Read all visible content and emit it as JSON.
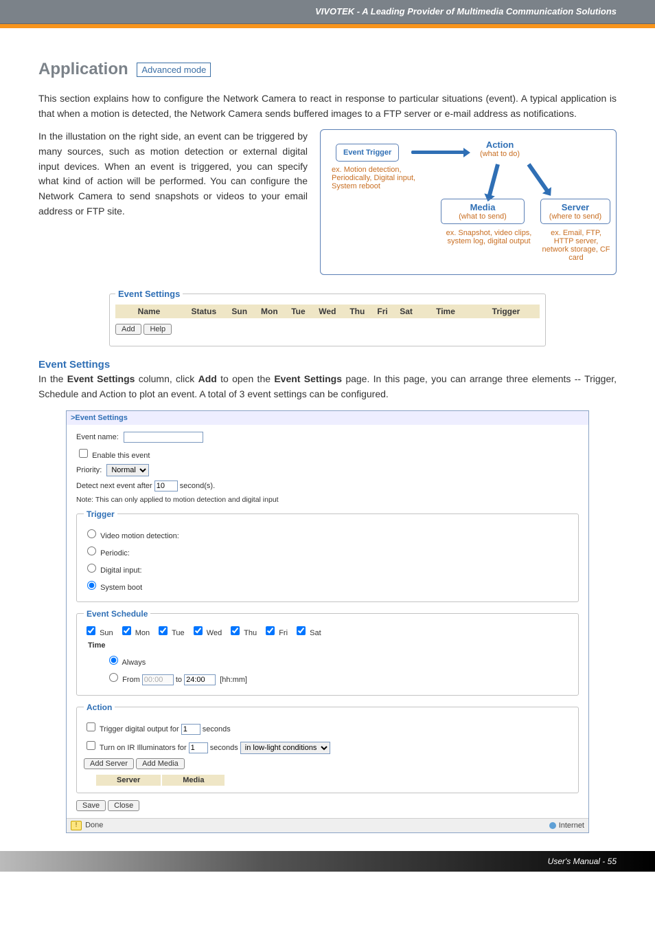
{
  "header": {
    "title": "VIVOTEK - A Leading Provider of Multimedia Communication Solutions"
  },
  "page": {
    "title": "Application",
    "badge": "Advanced mode",
    "intro": "This section explains how to configure the Network Camera to react in response to particular situations (event). A typical application is that when a motion is detected, the Network Camera sends buffered images to a FTP server or e-mail address as notifications.",
    "illustration_text": "In the illustation on the right side, an event can be triggered by many sources, such as motion detection or external digital input devices. When an event is triggered, you can specify what kind of action will be performed. You can configure the Network Camera to send snapshots or videos to your email address or FTP site."
  },
  "diagram": {
    "event_trigger": "Event Trigger",
    "action_title": "Action",
    "action_sub": "(what to do)",
    "media_title": "Media",
    "media_sub": "(what to send)",
    "server_title": "Server",
    "server_sub": "(where to send)",
    "ex1": "ex. Motion detection, Periodically, Digital input, System reboot",
    "ex2": "ex. Snapshot, video clips, system log, digital output",
    "ex3": "ex. Email, FTP, HTTP server, network storage, CF card"
  },
  "event_settings_overview": {
    "legend": "Event Settings",
    "columns": [
      "Name",
      "Status",
      "Sun",
      "Mon",
      "Tue",
      "Wed",
      "Thu",
      "Fri",
      "Sat",
      "Time",
      "Trigger"
    ],
    "add": "Add",
    "help": "Help"
  },
  "event_settings_section": {
    "heading": "Event Settings",
    "body_prefix": "In the ",
    "body_b1": "Event Settings",
    "body_mid1": " column, click ",
    "body_b2": "Add",
    "body_mid2": " to open the ",
    "body_b3": "Event Settings",
    "body_suffix": " page. In this page, you can arrange three elements -- Trigger, Schedule and Action to plot an event. A total of 3 event settings can be configured."
  },
  "modal": {
    "title": ">Event Settings",
    "event_name_label": "Event name:",
    "event_name_value": "",
    "enable_label": "Enable this event",
    "enable_checked": false,
    "priority_label": "Priority:",
    "priority_value": "Normal",
    "detect_prefix": "Detect next event after",
    "detect_value": "10",
    "detect_suffix": "second(s).",
    "note": "Note: This can only applied to motion detection and digital input",
    "trigger": {
      "legend": "Trigger",
      "options": [
        {
          "label": "Video motion detection:",
          "selected": false
        },
        {
          "label": "Periodic:",
          "selected": false
        },
        {
          "label": "Digital input:",
          "selected": false
        },
        {
          "label": "System boot",
          "selected": true
        }
      ]
    },
    "schedule": {
      "legend": "Event Schedule",
      "days": [
        "Sun",
        "Mon",
        "Tue",
        "Wed",
        "Thu",
        "Fri",
        "Sat"
      ],
      "days_checked": [
        true,
        true,
        true,
        true,
        true,
        true,
        true
      ],
      "time_label": "Time",
      "always_label": "Always",
      "always_selected": true,
      "from_label": "From",
      "from_value": "00:00",
      "to_label": "to",
      "to_value": "24:00",
      "hhmm": "[hh:mm]"
    },
    "action": {
      "legend": "Action",
      "trigger_do_prefix": "Trigger digital output for",
      "trigger_do_value": "1",
      "trigger_do_suffix": "seconds",
      "ir_prefix": "Turn on IR Illuminators for",
      "ir_value": "1",
      "ir_mid": "seconds",
      "ir_select": "in low-light conditions",
      "add_server": "Add Server",
      "add_media": "Add Media",
      "server_header": "Server",
      "media_header": "Media"
    },
    "save": "Save",
    "close": "Close",
    "status_done": "Done",
    "status_net": "Internet"
  },
  "footer": {
    "text": "User's Manual - 55"
  }
}
